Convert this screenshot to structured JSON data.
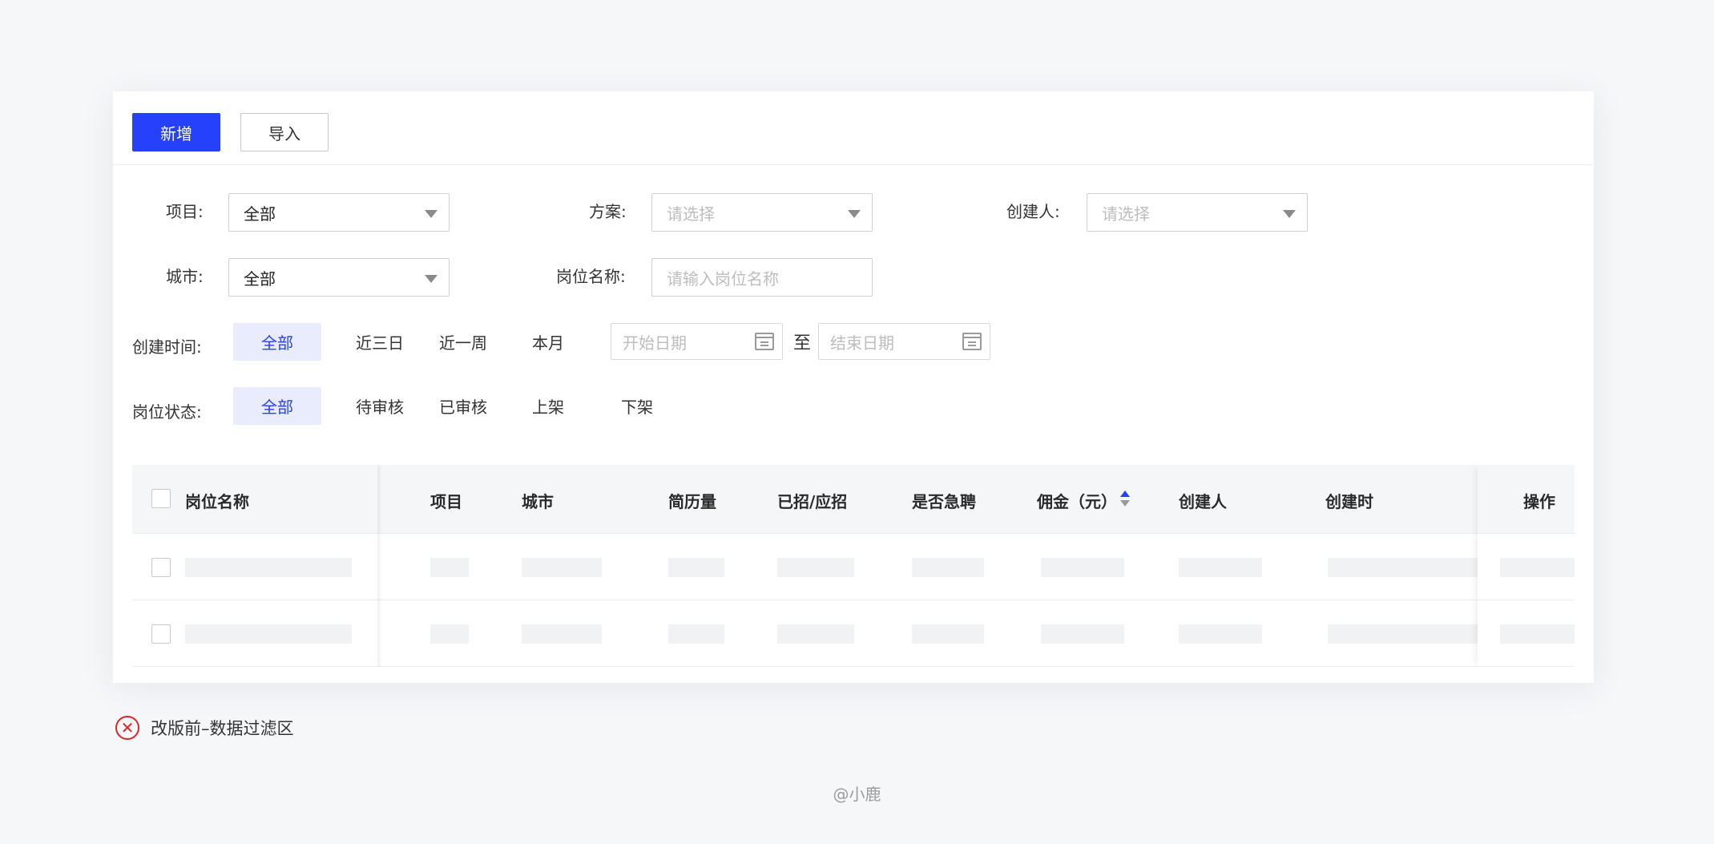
{
  "toolbar": {
    "add_label": "新增",
    "import_label": "导入"
  },
  "filters": {
    "project": {
      "label": "项目:",
      "value": "全部"
    },
    "plan": {
      "label": "方案:",
      "placeholder": "请选择"
    },
    "creator": {
      "label": "创建人:",
      "placeholder": "请选择"
    },
    "city": {
      "label": "城市:",
      "value": "全部"
    },
    "position_name": {
      "label": "岗位名称:",
      "placeholder": "请输入岗位名称"
    },
    "created_time": {
      "label": "创建时间:",
      "options": [
        "全部",
        "近三日",
        "近一周",
        "本月"
      ],
      "selected": "全部",
      "start_placeholder": "开始日期",
      "to_label": "至",
      "end_placeholder": "结束日期"
    },
    "status": {
      "label": "岗位状态:",
      "options": [
        "全部",
        "待审核",
        "已审核",
        "上架",
        "下架"
      ],
      "selected": "全部"
    }
  },
  "table": {
    "columns": [
      "岗位名称",
      "项目",
      "城市",
      "简历量",
      "已招/应招",
      "是否急聘",
      "佣金（元）",
      "创建人",
      "创建时",
      "操作"
    ]
  },
  "caption": {
    "icon": "close-circle-icon",
    "text": "改版前–数据过滤区"
  },
  "credit": "@小鹿",
  "colors": {
    "primary": "#2541fb",
    "error": "#e02424"
  }
}
